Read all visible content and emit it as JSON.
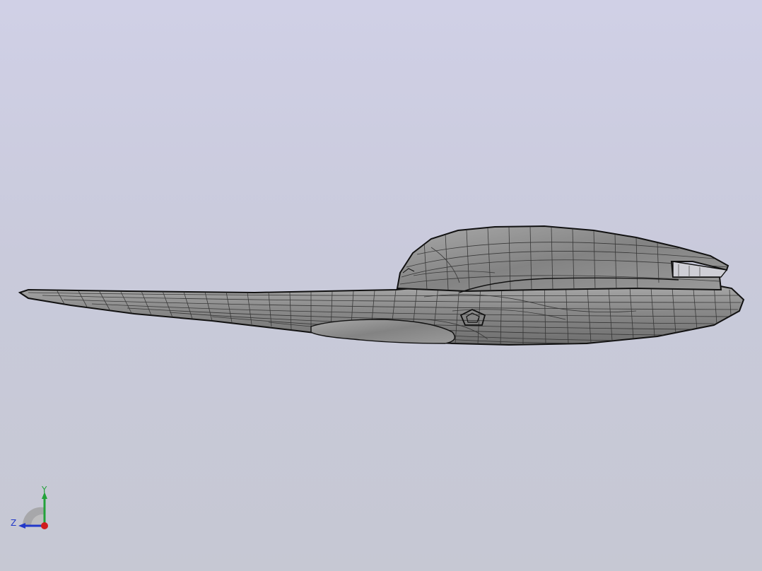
{
  "viewport": {
    "background_top": "#d0d0e6",
    "background_bottom": "#c6c8d3"
  },
  "model": {
    "name_icon": "cad-surface-model",
    "shading": "metallic-gray-with-edges",
    "surface_color": "#8d8d8d",
    "edge_color": "#1e1e1e"
  },
  "triad": {
    "y_label": "Y",
    "z_label": "Z",
    "x_color": "#d01c1c",
    "y_color": "#23a23a",
    "z_color": "#2238c9"
  }
}
